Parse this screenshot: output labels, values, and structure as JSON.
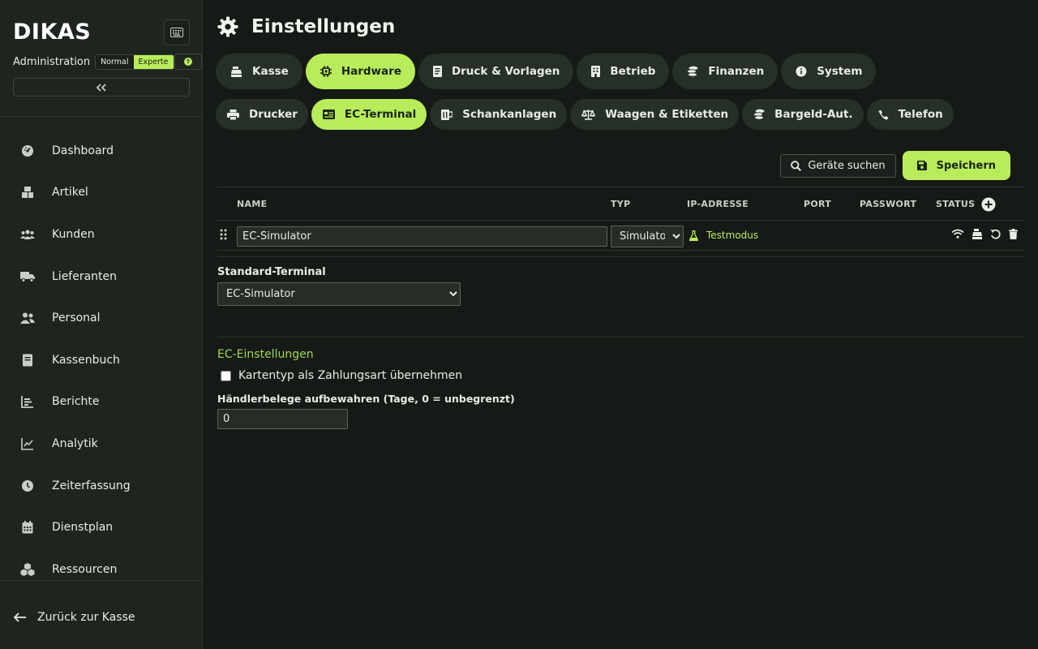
{
  "app": {
    "logo": "DIKAS",
    "admin_label": "Administration",
    "mode_normal": "Normal",
    "mode_expert": "Experte",
    "help_glyph": "?"
  },
  "sidebar": {
    "items": [
      {
        "label": "Dashboard",
        "icon": "gauge-icon"
      },
      {
        "label": "Artikel",
        "icon": "boxes-icon"
      },
      {
        "label": "Kunden",
        "icon": "users-icon"
      },
      {
        "label": "Lieferanten",
        "icon": "truck-icon"
      },
      {
        "label": "Personal",
        "icon": "staff-icon"
      },
      {
        "label": "Kassenbuch",
        "icon": "book-icon"
      },
      {
        "label": "Berichte",
        "icon": "bar-chart-icon"
      },
      {
        "label": "Analytik",
        "icon": "line-chart-icon"
      },
      {
        "label": "Zeiterfassung",
        "icon": "clock-icon"
      },
      {
        "label": "Dienstplan",
        "icon": "calendar-icon"
      },
      {
        "label": "Ressourcen",
        "icon": "cubes-icon"
      }
    ],
    "back_label": "Zurück zur Kasse"
  },
  "header": {
    "title": "Einstellungen"
  },
  "tabs_main": [
    {
      "label": "Kasse",
      "active": false
    },
    {
      "label": "Hardware",
      "active": true
    },
    {
      "label": "Druck & Vorlagen",
      "active": false
    },
    {
      "label": "Betrieb",
      "active": false
    },
    {
      "label": "Finanzen",
      "active": false
    },
    {
      "label": "System",
      "active": false
    }
  ],
  "tabs_sub": [
    {
      "label": "Drucker",
      "active": false
    },
    {
      "label": "EC-Terminal",
      "active": true
    },
    {
      "label": "Schankanlagen",
      "active": false
    },
    {
      "label": "Waagen & Etiketten",
      "active": false
    },
    {
      "label": "Bargeld-Aut.",
      "active": false
    },
    {
      "label": "Telefon",
      "active": false
    }
  ],
  "toolbar": {
    "search_label": "Geräte suchen",
    "save_label": "Speichern"
  },
  "table": {
    "headers": {
      "name": "NAME",
      "type": "TYP",
      "ip": "IP-ADRESSE",
      "port": "PORT",
      "password": "PASSWORT",
      "status": "STATUS"
    },
    "rows": [
      {
        "name": "EC-Simulator",
        "type": "Simulator",
        "status": "Testmodus"
      }
    ],
    "type_options": [
      "Simulator"
    ]
  },
  "standard_terminal": {
    "label": "Standard-Terminal",
    "value": "EC-Simulator"
  },
  "ec_settings": {
    "title": "EC-Einstellungen",
    "card_type_label": "Kartentyp als Zahlungsart übernehmen",
    "card_type_checked": false,
    "receipts_label": "Händlerbelege aufbewahren (Tage, 0 = unbegrenzt)",
    "receipts_value": "0"
  },
  "colors": {
    "accent": "#b8ec5a",
    "sidebar_bg": "#1e251f",
    "main_bg": "#161a16"
  }
}
